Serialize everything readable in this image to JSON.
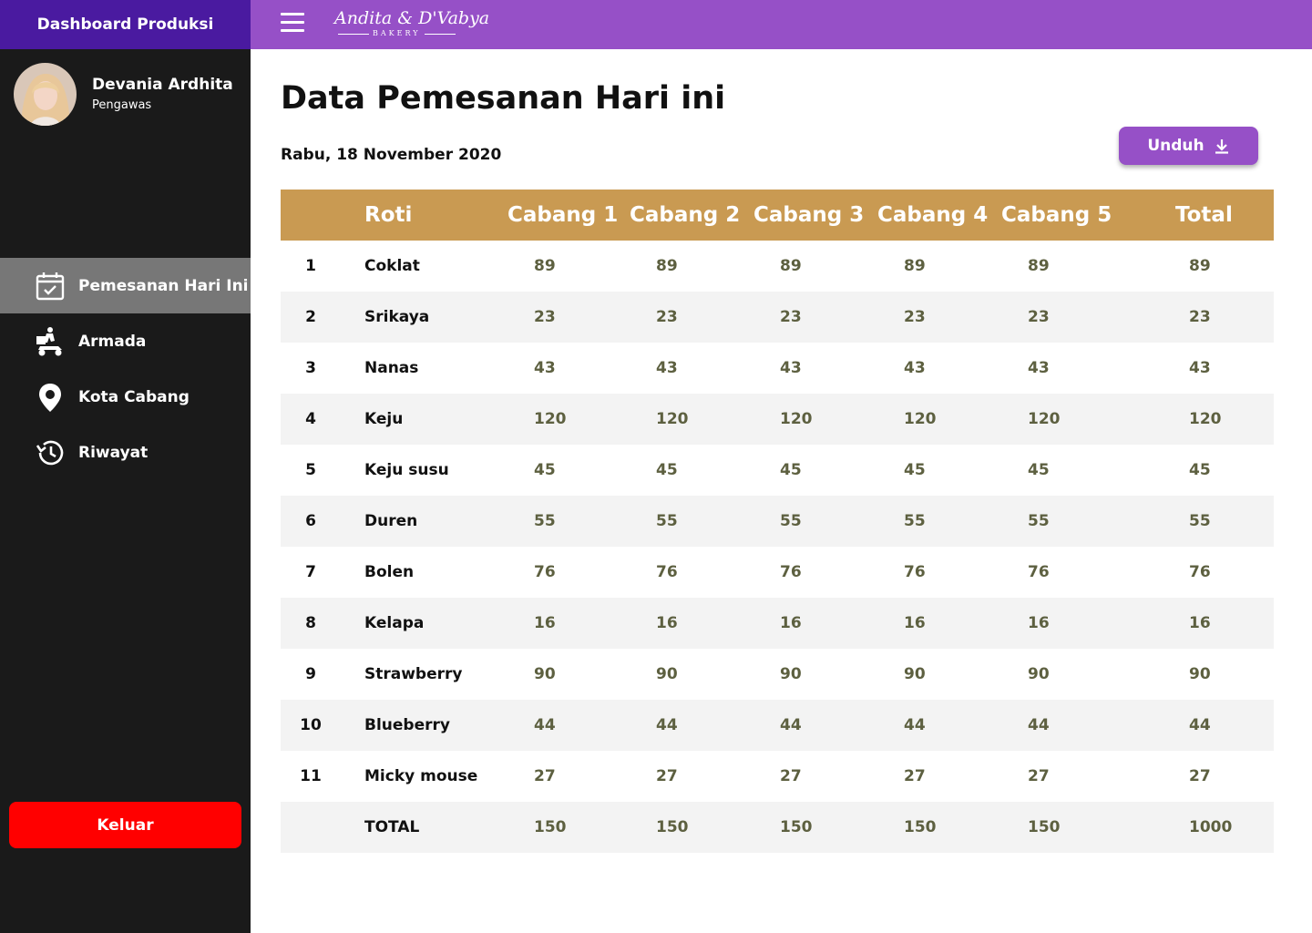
{
  "sidebar": {
    "title": "Dashboard Produksi",
    "profile": {
      "name": "Devania Ardhita",
      "role": "Pengawas"
    },
    "items": [
      {
        "label": "Pemesanan Hari Ini",
        "icon": "calendar-check-icon",
        "active": true
      },
      {
        "label": "Armada",
        "icon": "delivery-scooter-icon",
        "active": false
      },
      {
        "label": "Kota Cabang",
        "icon": "location-pin-icon",
        "active": false
      },
      {
        "label": "Riwayat",
        "icon": "history-icon",
        "active": false
      }
    ],
    "logout_label": "Keluar"
  },
  "topbar": {
    "menu_icon": "hamburger-menu-icon",
    "brand_name": "Andita & D'Vabya",
    "brand_sub": "BAKERY"
  },
  "main": {
    "title": "Data Pemesanan Hari ini",
    "date": "Rabu, 18 November 2020",
    "download_label": "Unduh",
    "download_icon": "download-icon"
  },
  "table": {
    "headers": [
      "",
      "Roti",
      "Cabang 1",
      "Cabang 2",
      "Cabang 3",
      "Cabang 4",
      "Cabang 5",
      "Total"
    ],
    "rows": [
      {
        "no": "1",
        "roti": "Coklat",
        "values": [
          "89",
          "89",
          "89",
          "89",
          "89",
          "89"
        ]
      },
      {
        "no": "2",
        "roti": "Srikaya",
        "values": [
          "23",
          "23",
          "23",
          "23",
          "23",
          "23"
        ]
      },
      {
        "no": "3",
        "roti": "Nanas",
        "values": [
          "43",
          "43",
          "43",
          "43",
          "43",
          "43"
        ]
      },
      {
        "no": "4",
        "roti": "Keju",
        "values": [
          "120",
          "120",
          "120",
          "120",
          "120",
          "120"
        ]
      },
      {
        "no": "5",
        "roti": "Keju susu",
        "values": [
          "45",
          "45",
          "45",
          "45",
          "45",
          "45"
        ]
      },
      {
        "no": "6",
        "roti": "Duren",
        "values": [
          "55",
          "55",
          "55",
          "55",
          "55",
          "55"
        ]
      },
      {
        "no": "7",
        "roti": "Bolen",
        "values": [
          "76",
          "76",
          "76",
          "76",
          "76",
          "76"
        ]
      },
      {
        "no": "8",
        "roti": "Kelapa",
        "values": [
          "16",
          "16",
          "16",
          "16",
          "16",
          "16"
        ]
      },
      {
        "no": "9",
        "roti": "Strawberry",
        "values": [
          "90",
          "90",
          "90",
          "90",
          "90",
          "90"
        ]
      },
      {
        "no": "10",
        "roti": "Blueberry",
        "values": [
          "44",
          "44",
          "44",
          "44",
          "44",
          "44"
        ]
      },
      {
        "no": "11",
        "roti": "Micky mouse",
        "values": [
          "27",
          "27",
          "27",
          "27",
          "27",
          "27"
        ]
      },
      {
        "no": "",
        "roti": "TOTAL",
        "values": [
          "150",
          "150",
          "150",
          "150",
          "150",
          "1000"
        ]
      }
    ]
  },
  "colors": {
    "sidebar_bg": "#1a1a1a",
    "sidebar_header": "#4a1aa0",
    "topbar": "#9650c7",
    "table_header": "#c99a52",
    "logout": "#ff0000",
    "value_text": "#5d6040"
  }
}
